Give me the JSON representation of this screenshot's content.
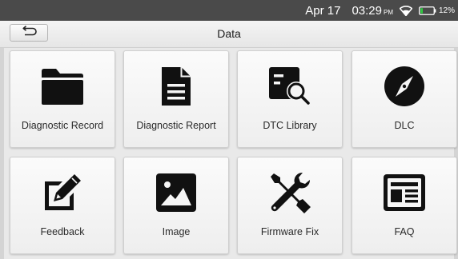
{
  "status_bar": {
    "date": "Apr 17",
    "time": "03:29",
    "ampm": "PM",
    "battery": "12%",
    "icons": [
      "wifi-icon",
      "battery-icon"
    ],
    "text_color": "#ffffff",
    "background": "#4a4a4a"
  },
  "header": {
    "title": "Data",
    "back_icon": "return-arrow-icon"
  },
  "tiles": [
    {
      "label": "Diagnostic Record",
      "icon": "folder-icon"
    },
    {
      "label": "Diagnostic Report",
      "icon": "document-icon"
    },
    {
      "label": "DTC Library",
      "icon": "search-list-icon"
    },
    {
      "label": "DLC",
      "icon": "compass-icon"
    },
    {
      "label": "Feedback",
      "icon": "pencil-edit-icon"
    },
    {
      "label": "Image",
      "icon": "image-icon"
    },
    {
      "label": "Firmware Fix",
      "icon": "tools-icon"
    },
    {
      "label": "FAQ",
      "icon": "news-icon"
    }
  ]
}
